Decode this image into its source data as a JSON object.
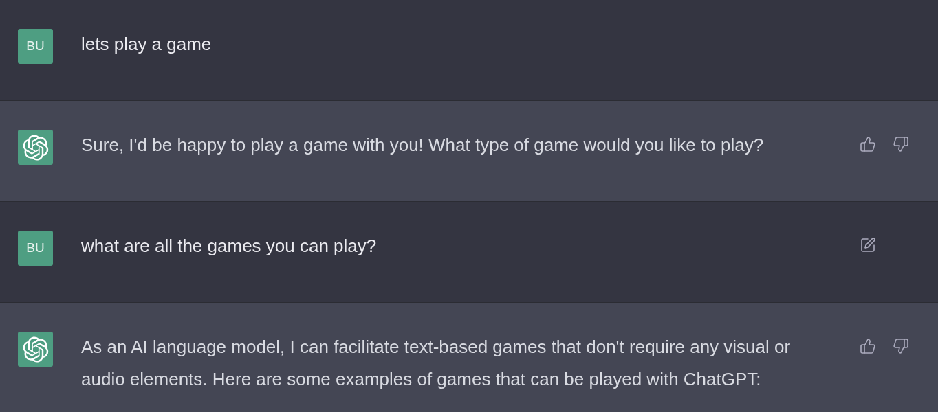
{
  "messages": [
    {
      "kind": "user",
      "avatar": "BU",
      "text": "lets play a game"
    },
    {
      "kind": "assistant",
      "text": "Sure, I'd be happy to play a game with you! What type of game would you like to play?",
      "actions": [
        {
          "kind": "thumbs_up"
        },
        {
          "kind": "thumbs_down"
        }
      ]
    },
    {
      "kind": "user",
      "avatar": "BU",
      "text": "what are all the games you can play?",
      "actions": [
        {
          "kind": "edit"
        }
      ]
    },
    {
      "kind": "assistant",
      "text": "As an AI language model, I can facilitate text-based games that don't require any visual or audio elements. Here are some examples of games that can be played with ChatGPT:",
      "actions": [
        {
          "kind": "thumbs_up"
        },
        {
          "kind": "thumbs_down"
        }
      ]
    }
  ]
}
